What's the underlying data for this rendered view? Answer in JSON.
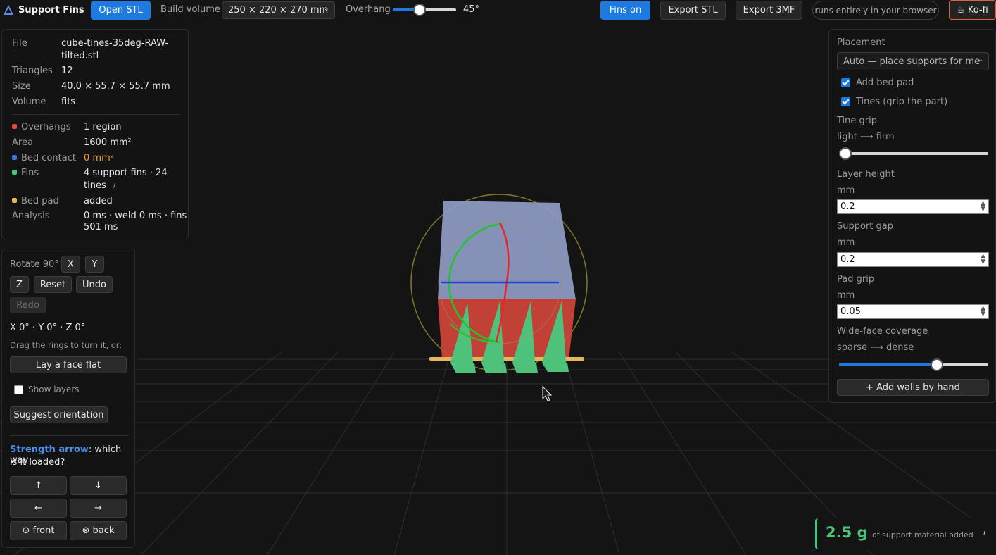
{
  "app": {
    "title": "Support Fins",
    "logo_icon": "triangle-logo-icon"
  },
  "toolbar": {
    "open_label": "Open STL",
    "build_volume_label": "Build volume",
    "build_volume_value": "250 × 220 × 270 mm",
    "overhang_label": "Overhang",
    "overhang_value": "45°",
    "overhang_fraction": 0.4,
    "fins_label": "Fins on",
    "export_stl_label": "Export STL",
    "export_3mf_label": "Export 3MF",
    "browser_note": "runs entirely in your browser",
    "kofi_label": "Ko-fi"
  },
  "file_info": {
    "file_label": "File",
    "file_value_line1": "cube-tines-35deg-RAW-",
    "file_value_line2": "tilted.stl",
    "triangles_label": "Triangles",
    "triangles_value": "12",
    "size_label": "Size",
    "size_value": "40.0 × 55.7 × 55.7 mm",
    "volume_label": "Volume",
    "volume_value": "fits",
    "overhangs_label": "Overhangs",
    "overhangs_value": "1 region",
    "area_label": "Area",
    "area_value": "1600 mm²",
    "bed_contact_label": "Bed contact",
    "bed_contact_value": "0 mm²",
    "fins_label": "Fins",
    "fins_value_line1": "4 support fins · 24",
    "fins_value_line2": "tines",
    "bed_pad_label": "Bed pad",
    "bed_pad_value": "added",
    "analysis_label": "Analysis",
    "analysis_value_line1": "0 ms · weld 0 ms · fins",
    "analysis_value_line2": "501 ms"
  },
  "rotate": {
    "rotate_label": "Rotate 90°",
    "x_label": "X",
    "y_label": "Y",
    "z_label": "Z",
    "reset_label": "Reset",
    "undo_label": "Undo",
    "redo_label": "Redo",
    "angles": "X 0° · Y 0° · Z 0°",
    "hint": "Drag the rings to turn it, or:",
    "lay_flat_label": "Lay a face flat",
    "show_layers_label": "Show layers",
    "show_layers_checked": false,
    "suggest_label": "Suggest orientation",
    "strength_title": "Strength arrow",
    "strength_rest_line1": ": which way",
    "strength_rest_line2": "is it loaded?",
    "arrow_up": "↑",
    "arrow_down": "↓",
    "arrow_left": "←",
    "arrow_right": "→",
    "front_label": "⊙ front",
    "back_label": "⊗ back"
  },
  "placement": {
    "title": "Placement",
    "mode_value": "Auto — place supports for me",
    "add_bed_pad_label": "Add bed pad",
    "add_bed_pad_checked": true,
    "tines_label": "Tines (grip the part)",
    "tines_checked": true,
    "tine_grip_label": "Tine grip",
    "tine_grip_range": "light ⟶ firm",
    "tine_grip_fraction": 0.0,
    "layer_height_label": "Layer height",
    "layer_height_unit": "mm",
    "layer_height_value": "0.2",
    "support_gap_label": "Support gap",
    "support_gap_unit": "mm",
    "support_gap_value": "0.2",
    "pad_grip_label": "Pad grip",
    "pad_grip_unit": "mm",
    "pad_grip_value": "0.05",
    "coverage_label": "Wide-face coverage",
    "coverage_range": "sparse ⟶ dense",
    "coverage_fraction": 0.67,
    "add_walls_label": "+ Add walls by hand"
  },
  "summary": {
    "weight_value": "2.5 g",
    "weight_caption": "of support material added",
    "info_icon": "info-icon"
  },
  "colors": {
    "accent": "#1f7ae0",
    "overhang": "#e0483a",
    "bed_contact": "#3f6fd8",
    "fins": "#4ec27a",
    "bed_pad": "#e8b65a",
    "warning": "#f0a030",
    "weight": "#4ec27a"
  }
}
